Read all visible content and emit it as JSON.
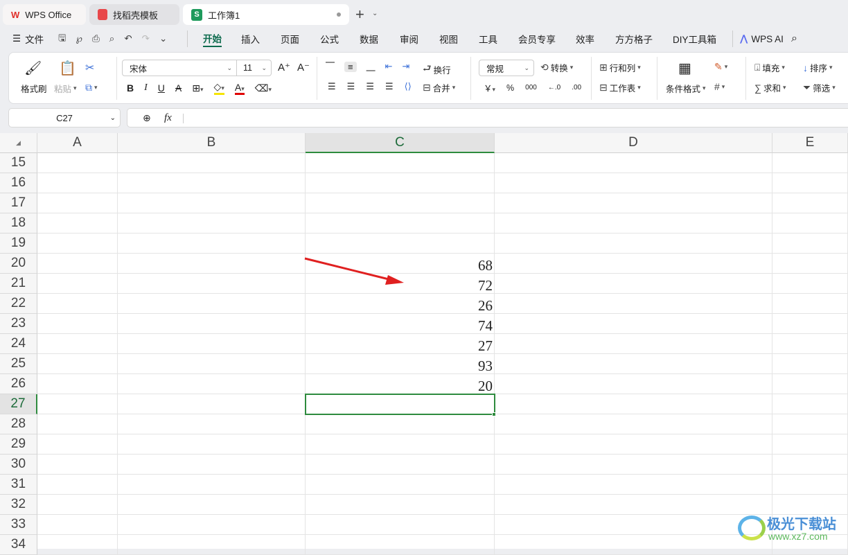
{
  "tabs": [
    {
      "label": "WPS Office"
    },
    {
      "label": "找稻壳模板"
    },
    {
      "label": "工作簿1"
    }
  ],
  "menu": {
    "file": "文件",
    "items": [
      "开始",
      "插入",
      "页面",
      "公式",
      "数据",
      "审阅",
      "视图",
      "工具",
      "会员专享",
      "效率",
      "方方格子",
      "DIY工具箱"
    ],
    "active": "开始",
    "ai": "WPS AI"
  },
  "ribbon": {
    "format_painter": "格式刷",
    "paste": "粘贴",
    "font": "宋体",
    "size": "11",
    "wrap": "换行",
    "merge": "合并",
    "number_format": "常规",
    "convert": "转换",
    "rows_cols": "行和列",
    "worksheet": "工作表",
    "cond_format": "条件格式",
    "fill": "填充",
    "sort": "排序",
    "sum": "求和",
    "filter": "筛选",
    "yen": "￥",
    "percent": "%"
  },
  "formula_bar": {
    "cell_ref": "C27",
    "fx": "fx",
    "value": ""
  },
  "columns": [
    "A",
    "B",
    "C",
    "D",
    "E"
  ],
  "rows": [
    "15",
    "16",
    "17",
    "18",
    "19",
    "20",
    "21",
    "22",
    "23",
    "24",
    "25",
    "26",
    "27",
    "28",
    "29",
    "30",
    "31",
    "32",
    "33",
    "34"
  ],
  "values": [
    "68",
    "72",
    "26",
    "74",
    "27",
    "93",
    "20"
  ],
  "selected": {
    "cell": "C27",
    "color": "#2e8b3e"
  },
  "watermark": {
    "title": "极光下载站",
    "url": "www.xz7.com"
  }
}
